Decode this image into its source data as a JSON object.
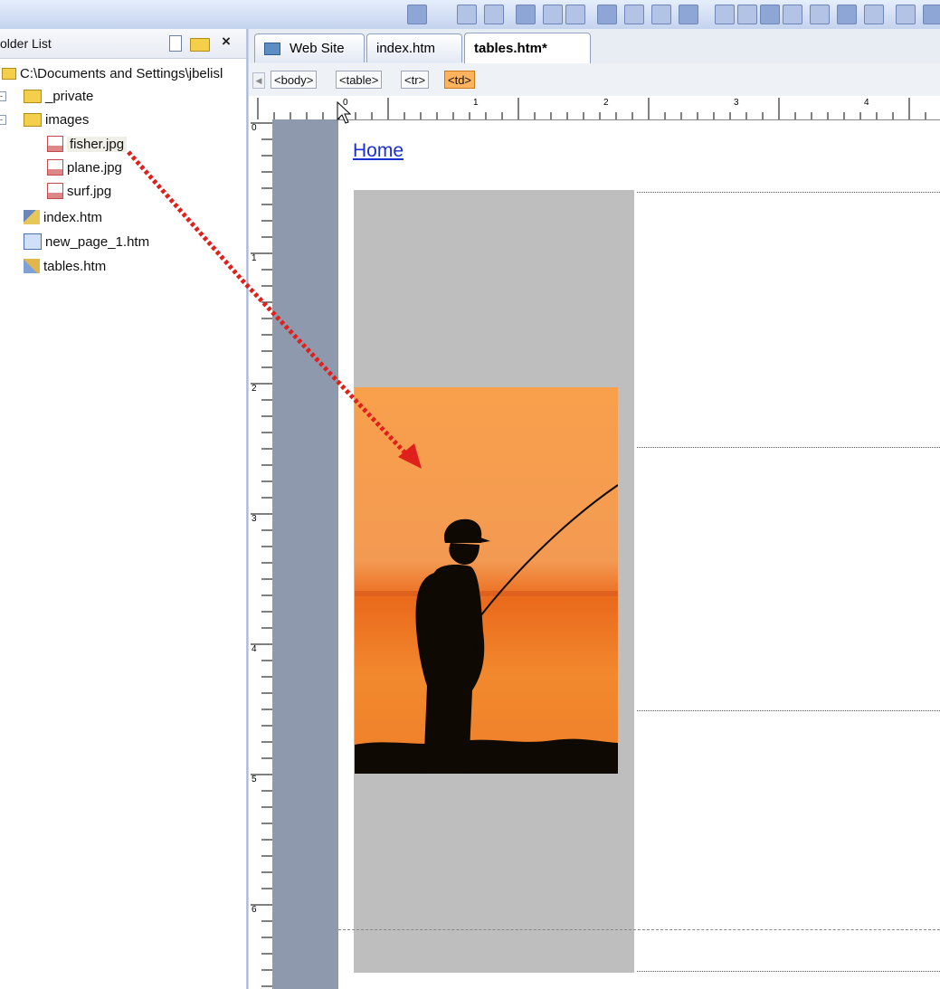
{
  "folder_list": {
    "title": "older List",
    "root": "C:\\Documents and Settings\\jbelisl",
    "items": [
      {
        "label": "_private",
        "type": "folder"
      },
      {
        "label": "images",
        "type": "folder"
      },
      {
        "label": "fisher.jpg",
        "type": "image"
      },
      {
        "label": "plane.jpg",
        "type": "image"
      },
      {
        "label": "surf.jpg",
        "type": "image"
      },
      {
        "label": "index.htm",
        "type": "home-page"
      },
      {
        "label": "new_page_1.htm",
        "type": "page"
      },
      {
        "label": "tables.htm",
        "type": "page-edit"
      }
    ]
  },
  "tabs": [
    "Web Site",
    "index.htm",
    "tables.htm*"
  ],
  "quick_tags": [
    "<body>",
    "<table>",
    "<tr>",
    "<td>"
  ],
  "ruler": {
    "horizontal": [
      "0",
      "1",
      "2",
      "3",
      "4"
    ],
    "vertical": [
      "0",
      "1",
      "2",
      "3",
      "4",
      "5",
      "6"
    ]
  },
  "page": {
    "link_text": "Home"
  },
  "colors": {
    "selected_tag": "#ffb35c",
    "cell_fill": "#bebebe",
    "margin": "#8e99ae",
    "link": "#1a2fd2",
    "drag_arrow": "#e0201a"
  },
  "icons": {
    "new_page": "new-page-icon",
    "new_folder": "new-folder-icon",
    "close": "close-icon",
    "drag": "drag-arrow-icon"
  }
}
